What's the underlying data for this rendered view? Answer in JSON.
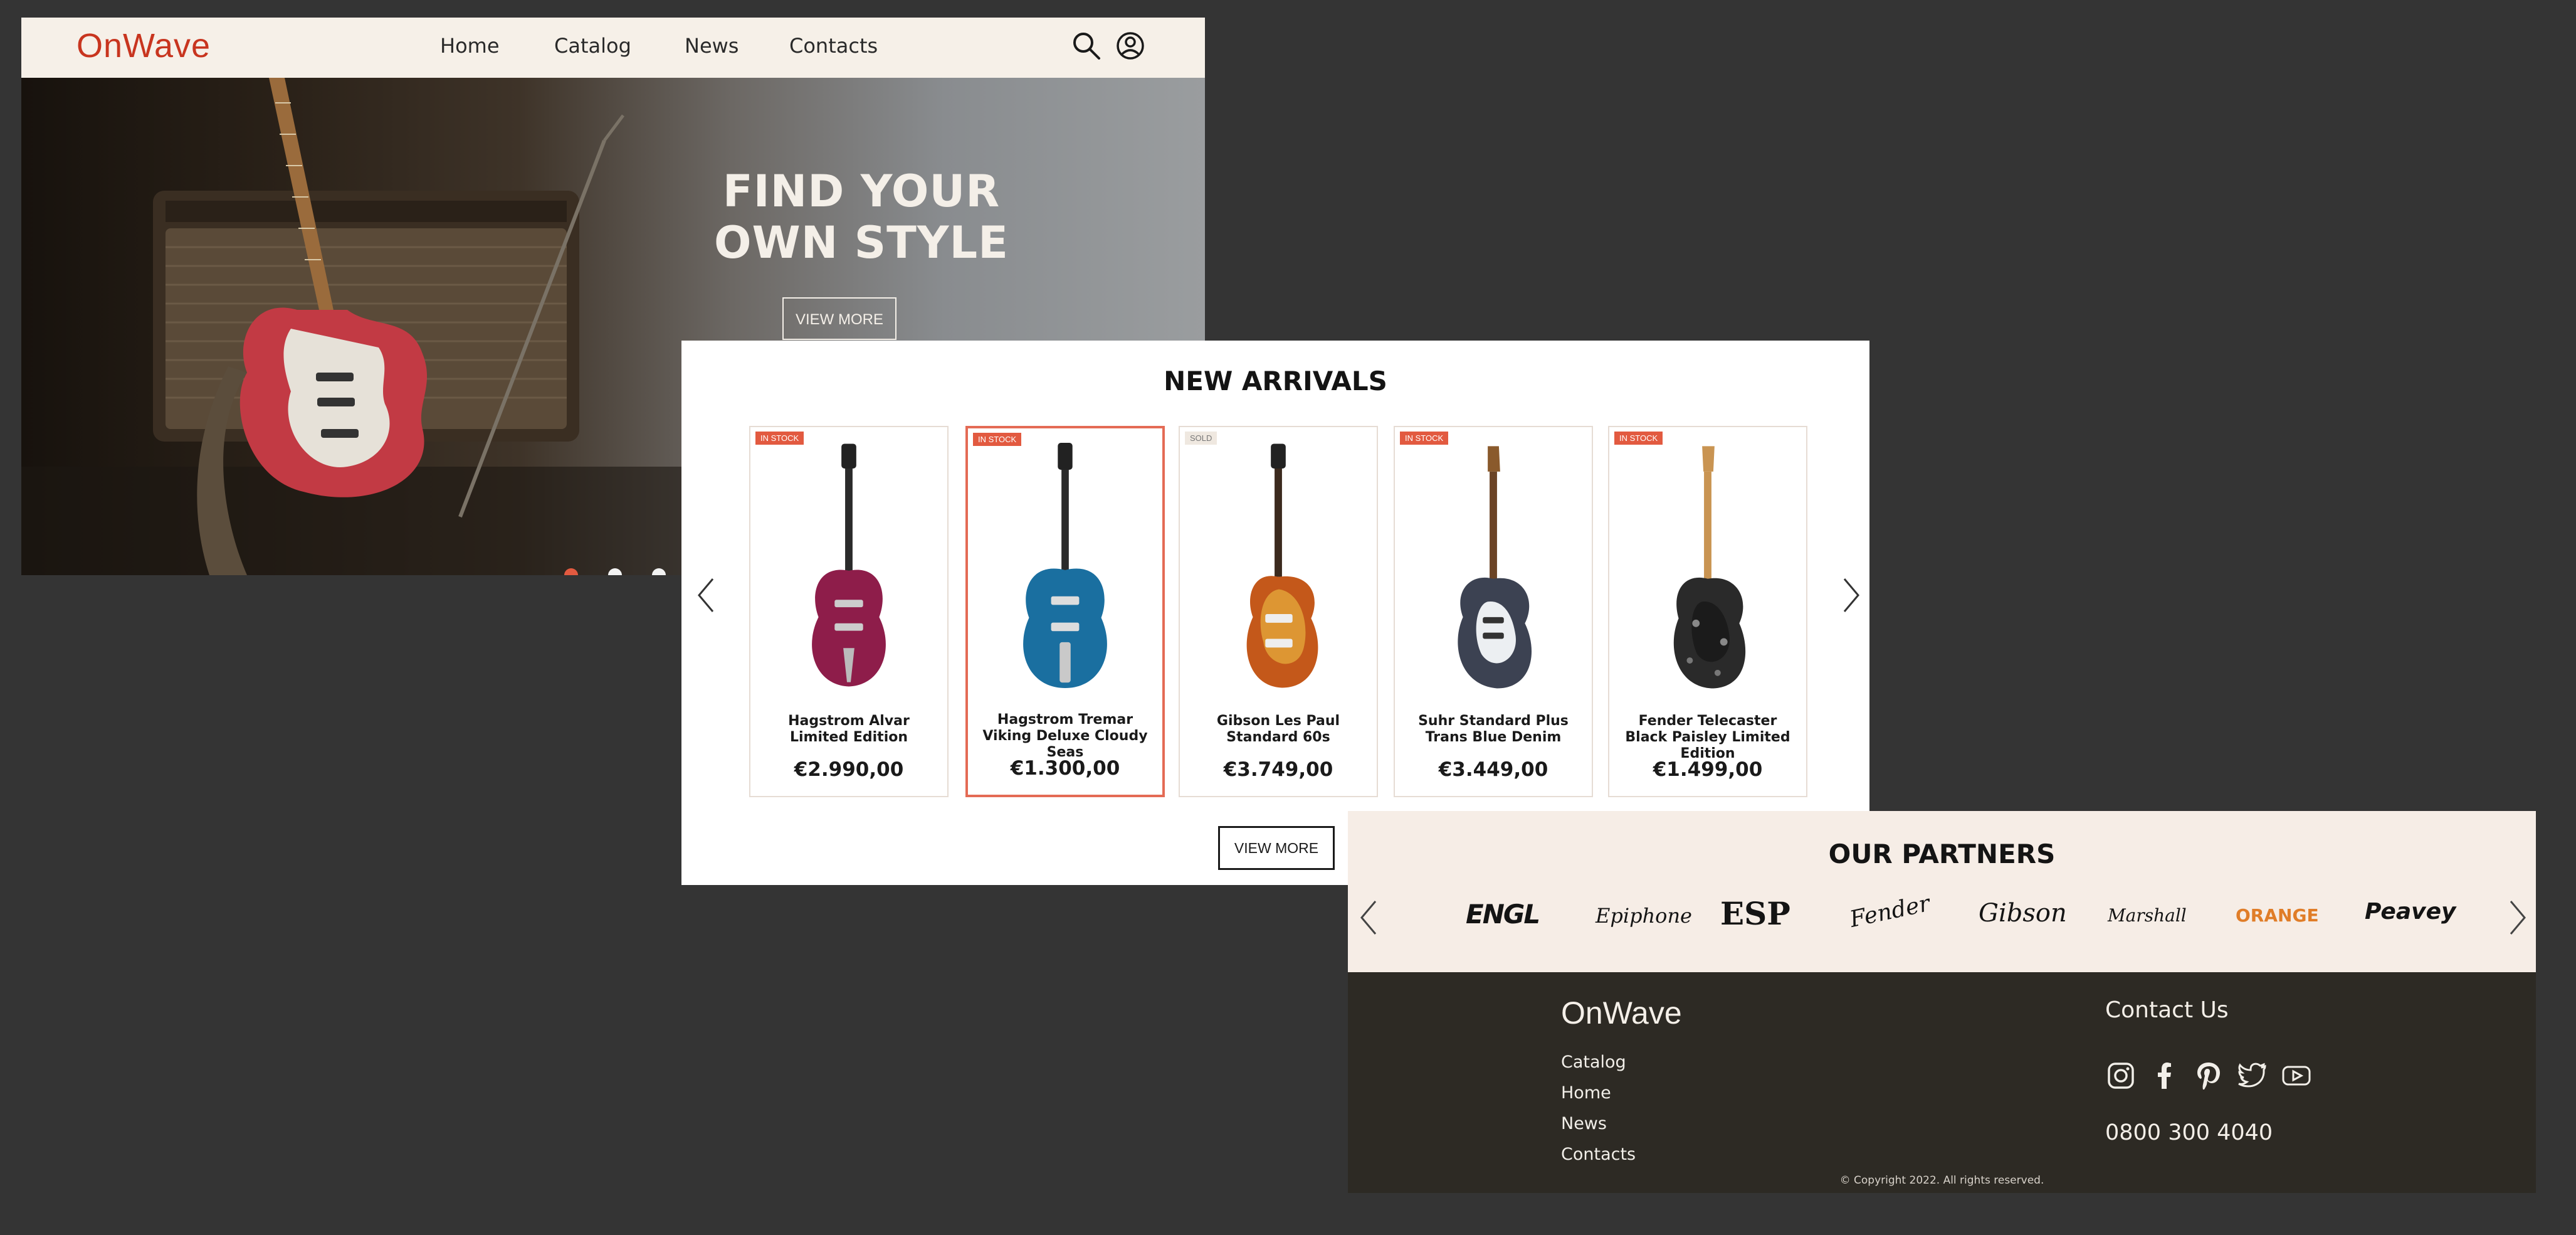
{
  "brand": {
    "name": "OnWave",
    "accent_color": "#c8351f"
  },
  "nav": {
    "links": [
      "Home",
      "Catalog",
      "News",
      "Contacts"
    ],
    "icons": [
      "search-icon",
      "user-icon"
    ]
  },
  "hero": {
    "title_line1": "FIND YOUR",
    "title_line2": "OWN STYLE",
    "button": "VIEW MORE",
    "carousel": {
      "slides": 3,
      "active": 1
    }
  },
  "arrivals": {
    "title": "NEW ARRIVALS",
    "button": "VIEW MORE",
    "products": [
      {
        "status": "IN STOCK",
        "name": "Hagstrom Alvar Limited Edition",
        "price": "€2.990,00",
        "color": "#8e1d4a"
      },
      {
        "status": "IN STOCK",
        "name": "Hagstrom Tremar Viking Deluxe Cloudy Seas",
        "price": "€1.300,00",
        "color": "#1a6fa0"
      },
      {
        "status": "SOLD",
        "name": "Gibson Les Paul Standard 60s",
        "price": "€3.749,00",
        "color": "#c4581a"
      },
      {
        "status": "IN STOCK",
        "name": "Suhr Standard Plus Trans Blue Denim",
        "price": "€3.449,00",
        "color": "#3c4252"
      },
      {
        "status": "IN STOCK",
        "name": "Fender Telecaster Black Paisley Limited Edition",
        "price": "€1.499,00",
        "color": "#2a2a2a"
      }
    ]
  },
  "partners": {
    "title": "OUR PARTNERS",
    "brands": [
      "ENGL",
      "Epiphone",
      "ESP",
      "Fender",
      "Gibson",
      "Marshall",
      "ORANGE",
      "Peavey"
    ]
  },
  "footer": {
    "logo": "OnWave",
    "links": [
      "Catalog",
      "Home",
      "News",
      "Contacts"
    ],
    "contact_title": "Contact Us",
    "social": [
      "instagram-icon",
      "facebook-icon",
      "pinterest-icon",
      "twitter-icon",
      "youtube-icon"
    ],
    "phone": "0800 300 4040",
    "copyright": "© Copyright 2022. All rights reserved."
  }
}
